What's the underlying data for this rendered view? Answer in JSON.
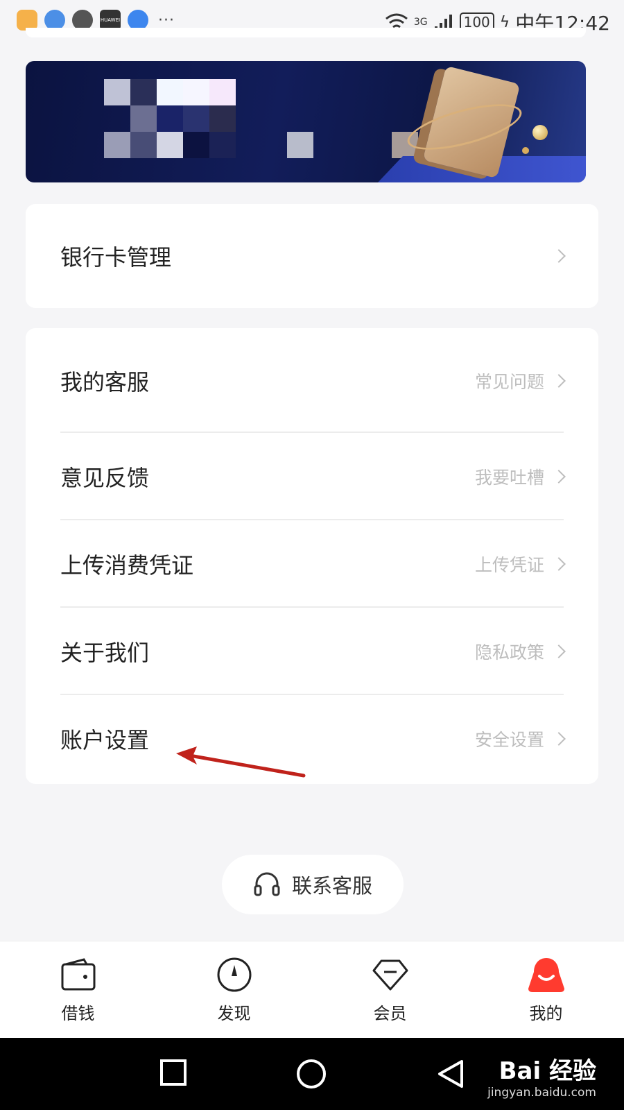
{
  "status_bar": {
    "time": "中午12:42",
    "battery": "100",
    "network": "3G"
  },
  "banner": {
    "description_hidden": ""
  },
  "bank_card": {
    "title": "银行卡管理"
  },
  "menu": {
    "items": [
      {
        "title": "我的客服",
        "hint": "常见问题"
      },
      {
        "title": "意见反馈",
        "hint": "我要吐槽"
      },
      {
        "title": "上传消费凭证",
        "hint": "上传凭证"
      },
      {
        "title": "关于我们",
        "hint": "隐私政策"
      },
      {
        "title": "账户设置",
        "hint": "安全设置"
      }
    ]
  },
  "contact": {
    "label": "联系客服",
    "icon": "headset-icon"
  },
  "bottom_nav": {
    "items": [
      {
        "label": "借钱",
        "icon": "wallet-icon",
        "active": false
      },
      {
        "label": "发现",
        "icon": "compass-icon",
        "active": false
      },
      {
        "label": "会员",
        "icon": "diamond-icon",
        "active": false
      },
      {
        "label": "我的",
        "icon": "profile-icon",
        "active": true
      }
    ],
    "active_color": "#ff3b2f"
  },
  "watermark": {
    "main": "Bai 经验",
    "sub": "jingyan.baidu.com"
  }
}
